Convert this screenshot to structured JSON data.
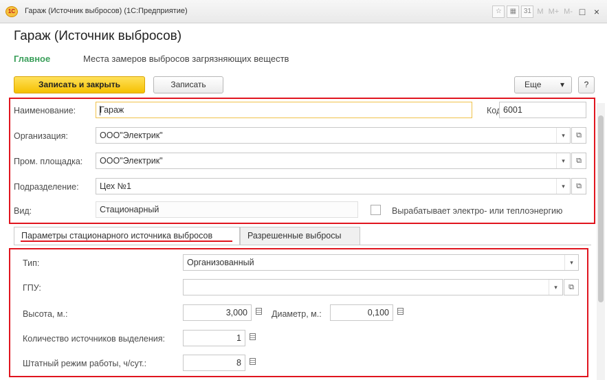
{
  "window": {
    "title": "Гараж (Источник выбросов) (1С:Предприятие)",
    "logo_text": "1C",
    "toolbar": {
      "m": "M",
      "m_plus": "M+",
      "m_minus": "M-",
      "restore": "□",
      "close": "×"
    }
  },
  "form": {
    "title": "Гараж (Источник выбросов)",
    "nav_main": "Главное",
    "nav_link": "Места замеров выбросов загрязняющих веществ"
  },
  "actions": {
    "save_close": "Записать и закрыть",
    "save": "Записать",
    "more": "Еще",
    "help": "?"
  },
  "fields": {
    "name_label": "Наименование:",
    "name_value": "Гараж",
    "code_label": "Код:",
    "code_value": "6001",
    "org_label": "Организация:",
    "org_value": "ООО\"Электрик\"",
    "site_label": "Пром. площадка:",
    "site_value": "ООО\"Электрик\"",
    "dept_label": "Подразделение:",
    "dept_value": "Цех №1",
    "kind_label": "Вид:",
    "kind_value": "Стационарный",
    "energy_label": "Вырабатывает электро- или теплоэнергию",
    "energy_checked": false
  },
  "tabs": {
    "params": "Параметры стационарного источника выбросов",
    "allowed": "Разрешенные выбросы"
  },
  "params": {
    "type_label": "Тип:",
    "type_value": "Организованный",
    "gpu_label": "ГПУ:",
    "gpu_value": "",
    "height_label": "Высота, м.:",
    "height_value": "3,000",
    "diameter_label": "Диаметр, м.:",
    "diameter_value": "0,100",
    "count_label": "Количество источников выделения:",
    "count_value": "1",
    "mode_label": "Штатный режим работы, ч/сут.:",
    "mode_value": "8"
  },
  "icons": {
    "dropdown": "▾",
    "open": "⧉",
    "calc": "calculator-icon"
  },
  "colors": {
    "accent_red": "#e0141e",
    "primary_yellow": "#f5c000",
    "nav_green": "#3a9f5a"
  }
}
